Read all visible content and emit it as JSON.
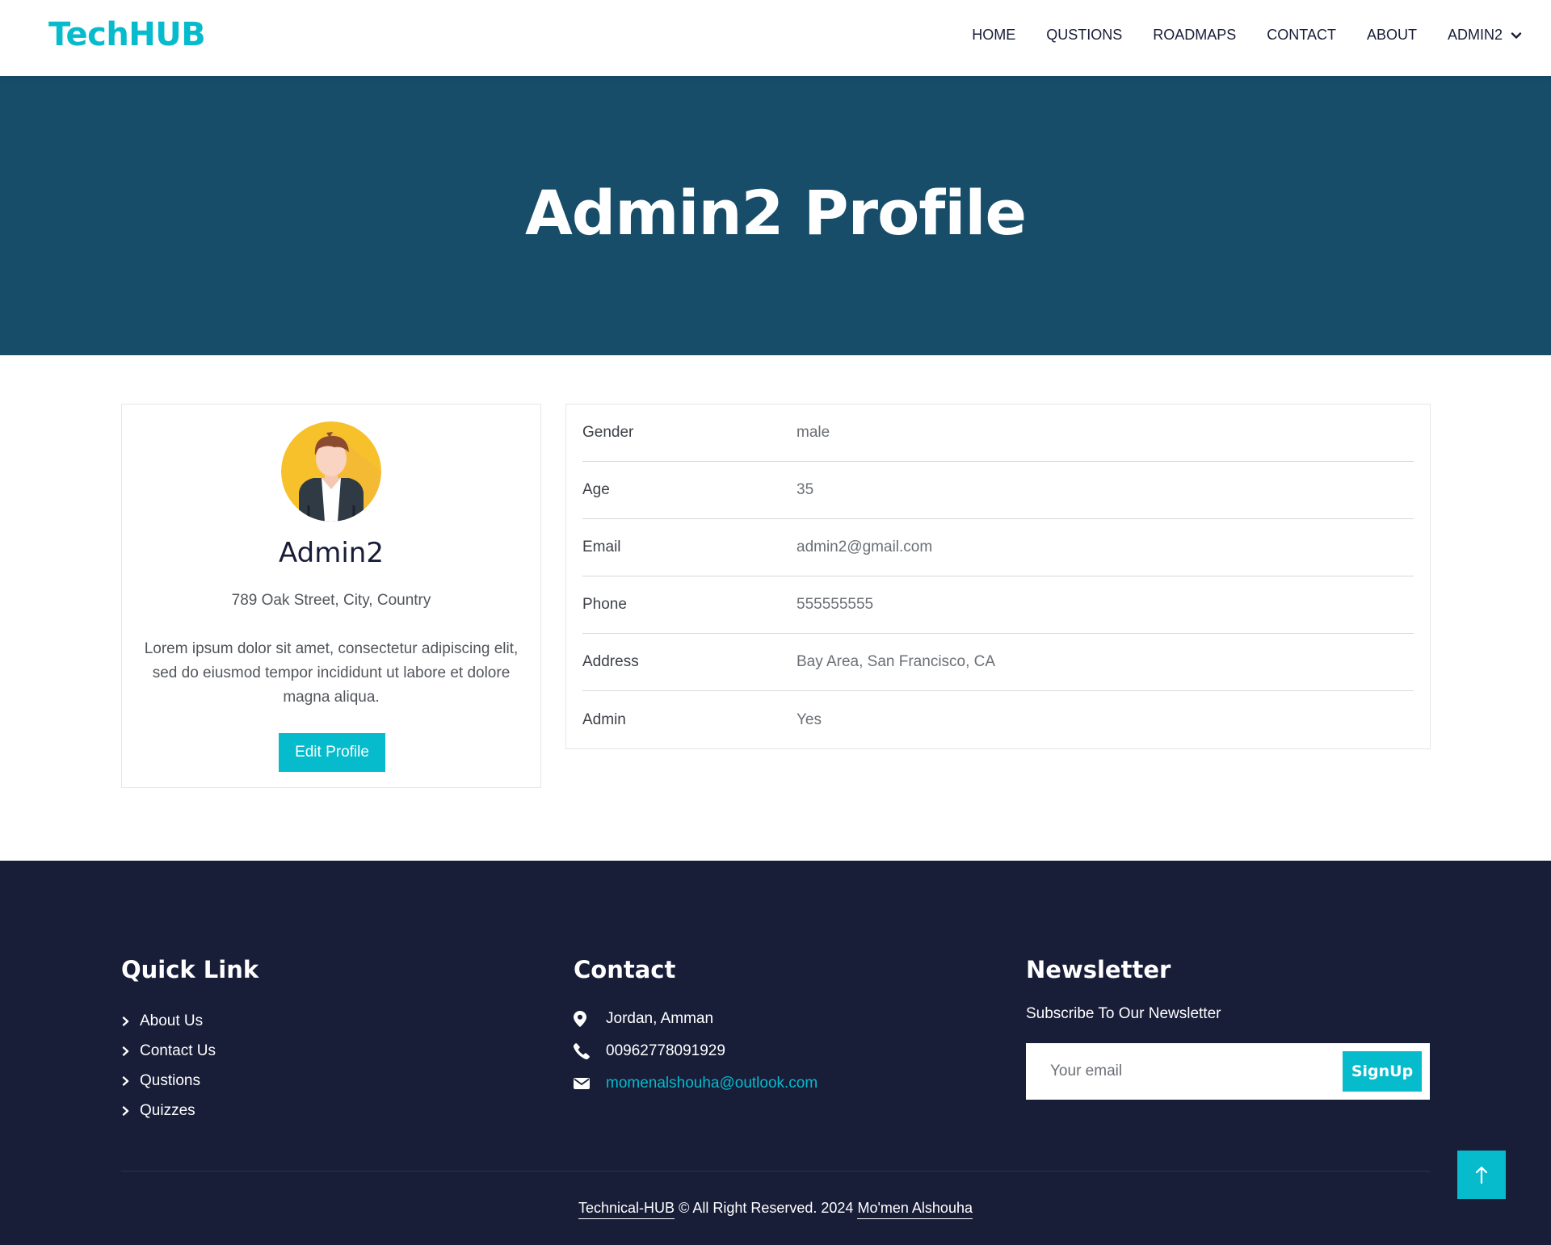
{
  "nav": {
    "brand": "TechHUB",
    "items": [
      "HOME",
      "QUSTIONS",
      "ROADMAPS",
      "CONTACT",
      "ABOUT"
    ],
    "user": "ADMIN2"
  },
  "hero": {
    "title": "Admin2 Profile"
  },
  "profile": {
    "name": "Admin2",
    "address": "789 Oak Street, City, Country",
    "bio": "Lorem ipsum dolor sit amet, consectetur adipiscing elit, sed do eiusmod tempor incididunt ut labore et dolore magna aliqua.",
    "edit_label": "Edit Profile"
  },
  "details": [
    {
      "label": "Gender",
      "value": "male"
    },
    {
      "label": "Age",
      "value": "35"
    },
    {
      "label": "Email",
      "value": "admin2@gmail.com"
    },
    {
      "label": "Phone",
      "value": "555555555"
    },
    {
      "label": "Address",
      "value": "Bay Area, San Francisco, CA"
    },
    {
      "label": "Admin",
      "value": "Yes"
    }
  ],
  "footer": {
    "quick_title": "Quick Link",
    "quick_links": [
      "About Us",
      "Contact Us",
      "Qustions",
      "Quizzes"
    ],
    "contact_title": "Contact",
    "location": "Jordan, Amman",
    "phone": "00962778091929",
    "email": "momenalshouha@outlook.com",
    "newsletter_title": "Newsletter",
    "newsletter_sub": "Subscribe To Our Newsletter",
    "newsletter_placeholder": "Your email",
    "signup_label": "SignUp",
    "copy_site": "Technical-HUB",
    "copy_text": " © All Right Reserved. 2024 ",
    "copy_author": "Mo'men Alshouha"
  },
  "colors": {
    "accent": "#06bbcc",
    "hero": "#174d69",
    "footer": "#181d38"
  },
  "icons": [
    "chevron-down-icon",
    "chevron-right-icon",
    "map-marker-icon",
    "phone-icon",
    "envelope-icon",
    "arrow-up-icon"
  ]
}
